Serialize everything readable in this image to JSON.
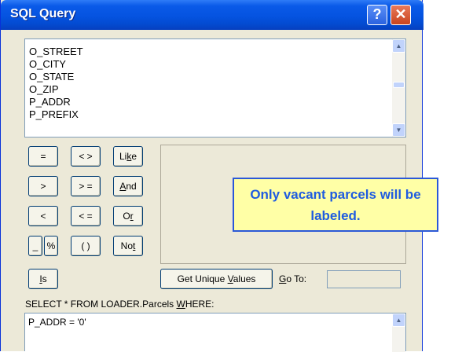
{
  "window": {
    "title": "SQL Query",
    "help_glyph": "?",
    "close_glyph": "✕"
  },
  "fields": {
    "items": [
      "O_STREET",
      "O_CITY",
      "O_STATE",
      "O_ZIP",
      "P_ADDR",
      "P_PREFIX"
    ]
  },
  "operators": {
    "eq": "=",
    "ne": "< >",
    "like": "Like",
    "gt": ">",
    "ge": "> =",
    "and": "And",
    "lt": "<",
    "le": "< =",
    "or": "Or",
    "underscore": "_",
    "percent": "%",
    "parens": "( )",
    "not": "Not",
    "is": "Is"
  },
  "values_panel": {
    "unique_values_label": "Get Unique Values",
    "goto_label": "Go To:",
    "goto_value": ""
  },
  "callout": {
    "text": "Only vacant parcels will be labeled."
  },
  "query": {
    "prefix_label": "SELECT * FROM LOADER.Parcels WHERE:",
    "where_clause": "P_ADDR = '0'"
  },
  "colors": {
    "titlebar": "#0553e0",
    "callout_bg": "#ffffa6",
    "callout_text": "#1f5ce0"
  }
}
